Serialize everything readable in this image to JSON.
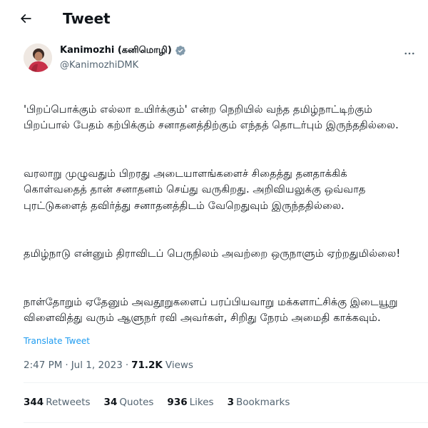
{
  "header": {
    "title": "Tweet"
  },
  "author": {
    "display_name": "Kanimozhi (கனிமொழி)",
    "handle": "@KanimozhiDMK",
    "verified": true
  },
  "tweet": {
    "paragraphs": [
      "'பிறப்பொக்கும் எல்லா உயிர்க்கும்' என்ற நெறியில் வந்த தமிழ்நாட்டிற்கும் பிறப்பால் பேதம் கற்பிக்கும் சனாதனத்திற்கும் எந்தத் தொடர்பும் இருந்ததில்லை.",
      "வரலாறு முழுவதும் பிறரது அடையாளங்களைச் சிதைத்து தனதாக்கிக் கொள்வதைத் தான் சனாதனம் செய்து வருகிறது. அறிவியலுக்கு ஒவ்வாத புரட்டுகளைத் தவிர்த்து சனாதனத்திடம் வேறெதுவும் இருந்ததில்லை.",
      "தமிழ்நாடு என்னும் திராவிடப் பெருநிலம் அவற்றை ஒருநாளும் ஏற்றதுமில்லை!",
      "நாள்தோறும் ஏதேனும் அவதூறுகளைப் பரப்பியவாறு மக்களாட்சிக்கு இடையூறு விளைவித்து வரும் ஆளுநர் ரவி அவர்கள், சிறிது நேரம் அமைதி காக்கவும்."
    ],
    "translate_label": "Translate Tweet"
  },
  "meta": {
    "time": "2:47 PM",
    "separator": "·",
    "date": "Jul 1, 2023",
    "views_count": "71.2K",
    "views_label": "Views"
  },
  "stats": {
    "retweets": {
      "count": "344",
      "label": "Retweets"
    },
    "quotes": {
      "count": "34",
      "label": "Quotes"
    },
    "likes": {
      "count": "936",
      "label": "Likes"
    },
    "bookmarks": {
      "count": "3",
      "label": "Bookmarks"
    }
  },
  "colors": {
    "accent": "#1d9bf0",
    "secondary_text": "#536471",
    "primary_text": "#0f1419",
    "divider": "#eff3f4"
  },
  "icons": {
    "back": "arrow-left-icon",
    "verified": "verified-badge-icon",
    "more": "more-horizontal-icon"
  }
}
